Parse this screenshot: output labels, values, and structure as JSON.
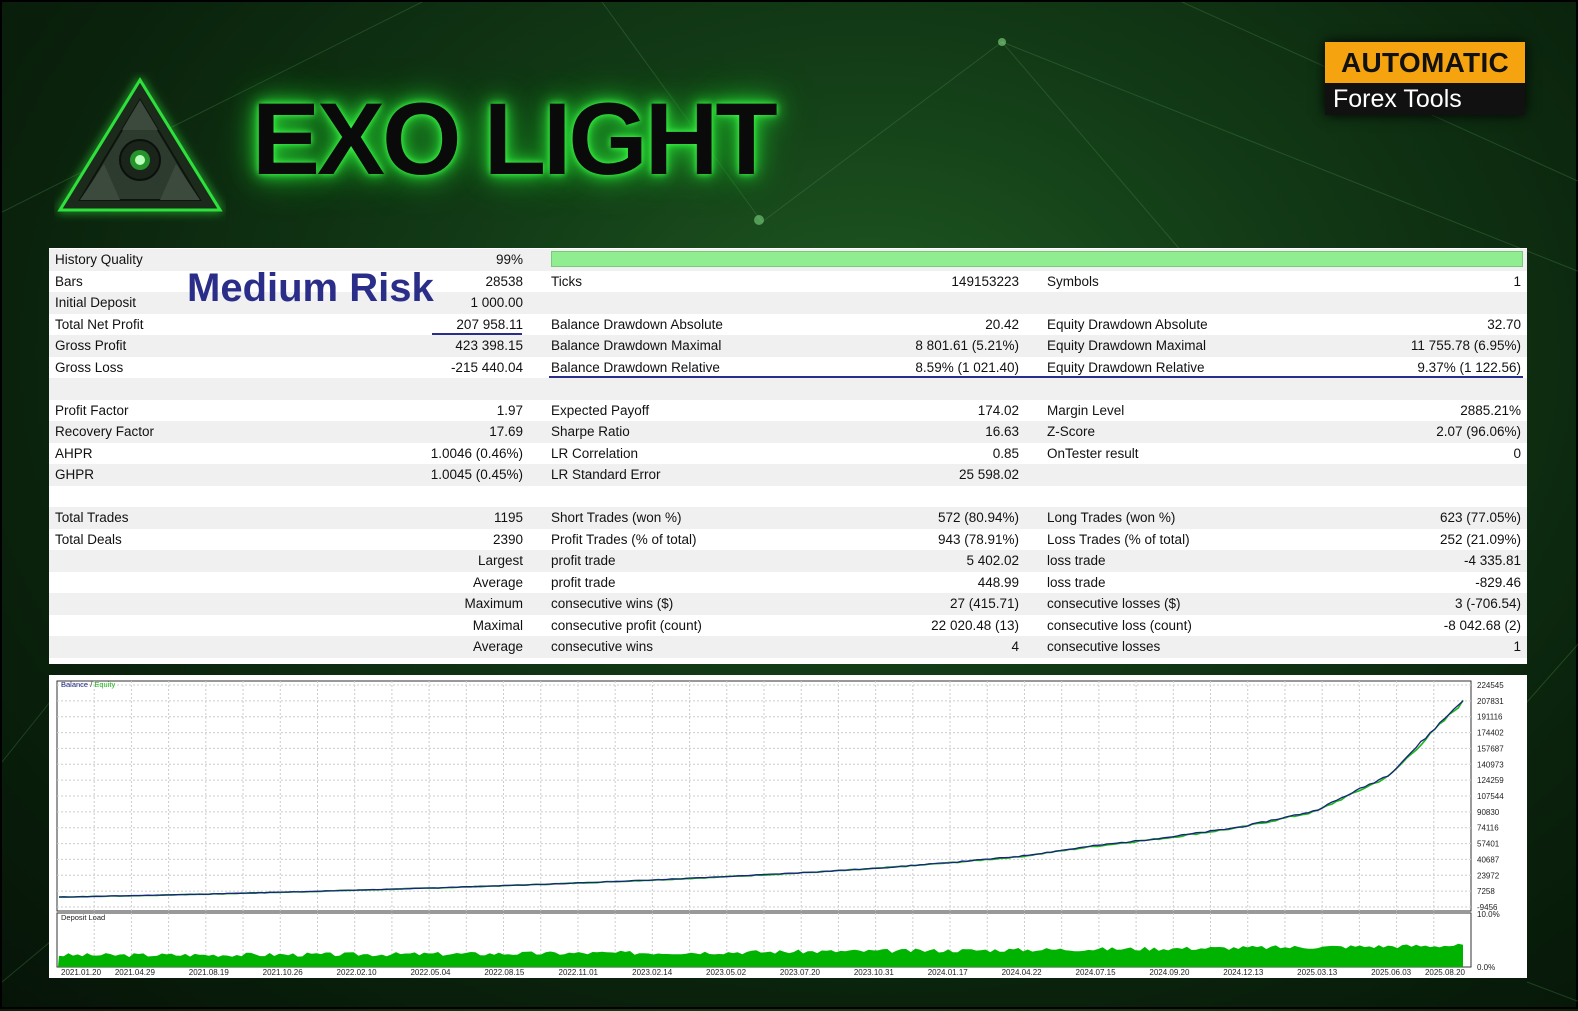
{
  "brand": {
    "top": "AUTOMATIC",
    "bottom": "Forex Tools"
  },
  "logo": {
    "title": "EXO LIGHT"
  },
  "risk_label": "Medium Risk",
  "report": {
    "rows": [
      {
        "l1": "History Quality",
        "v1": "99%",
        "l2": "",
        "v2": "",
        "l3": "",
        "v3": ""
      },
      {
        "l1": "Bars",
        "v1": "28538",
        "l2": "Ticks",
        "v2": "149153223",
        "l3": "Symbols",
        "v3": "1"
      },
      {
        "l1": "Initial Deposit",
        "v1": "1 000.00",
        "l2": "",
        "v2": "",
        "l3": "",
        "v3": ""
      },
      {
        "l1": "Total Net Profit",
        "v1": "207 958.11",
        "l2": "Balance Drawdown Absolute",
        "v2": "20.42",
        "l3": "Equity Drawdown Absolute",
        "v3": "32.70"
      },
      {
        "l1": "Gross Profit",
        "v1": "423 398.15",
        "l2": "Balance Drawdown Maximal",
        "v2": "8 801.61 (5.21%)",
        "l3": "Equity Drawdown Maximal",
        "v3": "11 755.78 (6.95%)"
      },
      {
        "l1": "Gross Loss",
        "v1": "-215 440.04",
        "l2": "Balance Drawdown Relative",
        "v2": "8.59% (1 021.40)",
        "l3": "Equity Drawdown Relative",
        "v3": "9.37% (1 122.56)"
      },
      {
        "l1": "",
        "v1": "",
        "l2": "",
        "v2": "",
        "l3": "",
        "v3": ""
      },
      {
        "l1": "Profit Factor",
        "v1": "1.97",
        "l2": "Expected Payoff",
        "v2": "174.02",
        "l3": "Margin Level",
        "v3": "2885.21%"
      },
      {
        "l1": "Recovery Factor",
        "v1": "17.69",
        "l2": "Sharpe Ratio",
        "v2": "16.63",
        "l3": "Z-Score",
        "v3": "2.07 (96.06%)"
      },
      {
        "l1": "AHPR",
        "v1": "1.0046 (0.46%)",
        "l2": "LR Correlation",
        "v2": "0.85",
        "l3": "OnTester result",
        "v3": "0"
      },
      {
        "l1": "GHPR",
        "v1": "1.0045 (0.45%)",
        "l2": "LR Standard Error",
        "v2": "25 598.02",
        "l3": "",
        "v3": ""
      },
      {
        "l1": "",
        "v1": "",
        "l2": "",
        "v2": "",
        "l3": "",
        "v3": ""
      },
      {
        "l1": "Total Trades",
        "v1": "1195",
        "l2": "Short Trades (won %)",
        "v2": "572 (80.94%)",
        "l3": "Long Trades (won %)",
        "v3": "623 (77.05%)"
      },
      {
        "l1": "Total Deals",
        "v1": "2390",
        "l2": "Profit Trades (% of total)",
        "v2": "943 (78.91%)",
        "l3": "Loss Trades (% of total)",
        "v3": "252 (21.09%)"
      },
      {
        "l1": "",
        "v1": "Largest",
        "l2": "profit trade",
        "v2": "5 402.02",
        "l3": "loss trade",
        "v3": "-4 335.81"
      },
      {
        "l1": "",
        "v1": "Average",
        "l2": "profit trade",
        "v2": "448.99",
        "l3": "loss trade",
        "v3": "-829.46"
      },
      {
        "l1": "",
        "v1": "Maximum",
        "l2": "consecutive wins ($)",
        "v2": "27 (415.71)",
        "l3": "consecutive losses ($)",
        "v3": "3 (-706.54)"
      },
      {
        "l1": "",
        "v1": "Maximal",
        "l2": "consecutive profit (count)",
        "v2": "22 020.48 (13)",
        "l3": "consecutive loss (count)",
        "v3": "-8 042.68 (2)"
      },
      {
        "l1": "",
        "v1": "Average",
        "l2": "consecutive wins",
        "v2": "4",
        "l3": "consecutive losses",
        "v3": "1"
      }
    ]
  },
  "chart": {
    "legend_balance": "Balance",
    "legend_sep": " / ",
    "legend_equity": "Equity",
    "deposit_load_label": "Deposit Load",
    "load_max_label": "10.0%",
    "load_min_label": "0.0%",
    "colors": {
      "balance": "#1a237e",
      "equity": "#18b818",
      "load": "#00b300"
    }
  },
  "chart_data": {
    "type": "line",
    "y_ticks": [
      "224545",
      "207831",
      "191116",
      "174402",
      "157687",
      "140973",
      "124259",
      "107544",
      "90830",
      "74116",
      "57401",
      "40687",
      "23972",
      "7258",
      "-9456"
    ],
    "ylim": [
      -9456,
      224545
    ],
    "x_ticks": [
      "2021.01.20",
      "2021.04.29",
      "2021.08.19",
      "2021.10.26",
      "2022.02.10",
      "2022.05.04",
      "2022.08.15",
      "2022.11.01",
      "2023.02.14",
      "2023.05.02",
      "2023.07.20",
      "2023.10.31",
      "2024.01.17",
      "2024.04.22",
      "2024.07.15",
      "2024.09.20",
      "2024.12.13",
      "2025.03.13",
      "2025.06.03",
      "2025.08.20"
    ],
    "series": [
      {
        "name": "Balance",
        "values": [
          1000,
          2500,
          4200,
          6100,
          8300,
          10500,
          13000,
          15800,
          19000,
          22500,
          26500,
          31000,
          37000,
          44000,
          55000,
          64000,
          75000,
          92000,
          130000,
          208958
        ]
      },
      {
        "name": "Equity",
        "values": [
          1000,
          2400,
          4100,
          6000,
          8200,
          10400,
          12900,
          15700,
          18800,
          22300,
          26300,
          30800,
          36800,
          43600,
          54500,
          63500,
          74500,
          91000,
          128500,
          207000
        ]
      }
    ],
    "deposit_load": {
      "ylim": [
        0,
        10.0
      ],
      "start": 1.8,
      "end": 3.6
    }
  }
}
